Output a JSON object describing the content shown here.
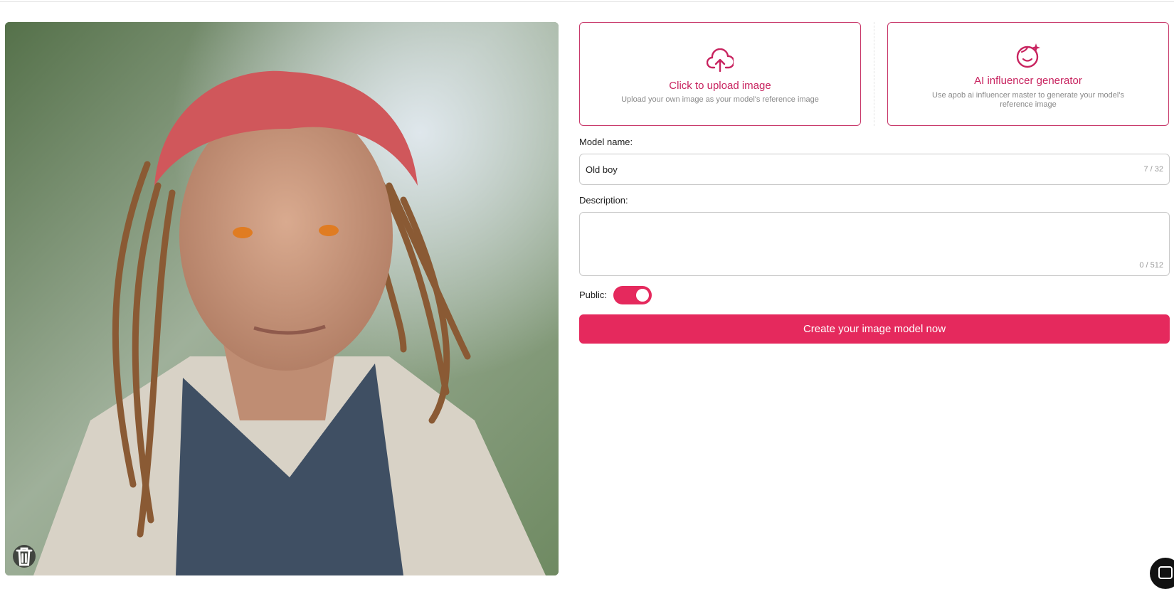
{
  "image_panel": {
    "image_alt": "Portrait of elderly man with red dreadlocks",
    "delete_icon": "trash-icon"
  },
  "upload_card": {
    "icon": "cloud-upload-icon",
    "title": "Click to upload image",
    "subtitle": "Upload your own image as your model's reference image"
  },
  "ai_card": {
    "icon": "face-sparkle-icon",
    "title": "AI influencer generator",
    "subtitle": "Use apob ai influencer master to generate your model's reference image"
  },
  "form": {
    "model_name_label": "Model name:",
    "model_name_value": "Old boy",
    "model_name_counter": "7 / 32",
    "description_label": "Description:",
    "description_value": "",
    "description_counter": "0 / 512",
    "public_label": "Public:",
    "public_enabled": true,
    "submit_label": "Create your image model now"
  },
  "chat_widget": {
    "icon": "chat-icon"
  },
  "colors": {
    "accent": "#e5295d",
    "accent_text": "#c8235f",
    "border": "#c9c9c9"
  }
}
